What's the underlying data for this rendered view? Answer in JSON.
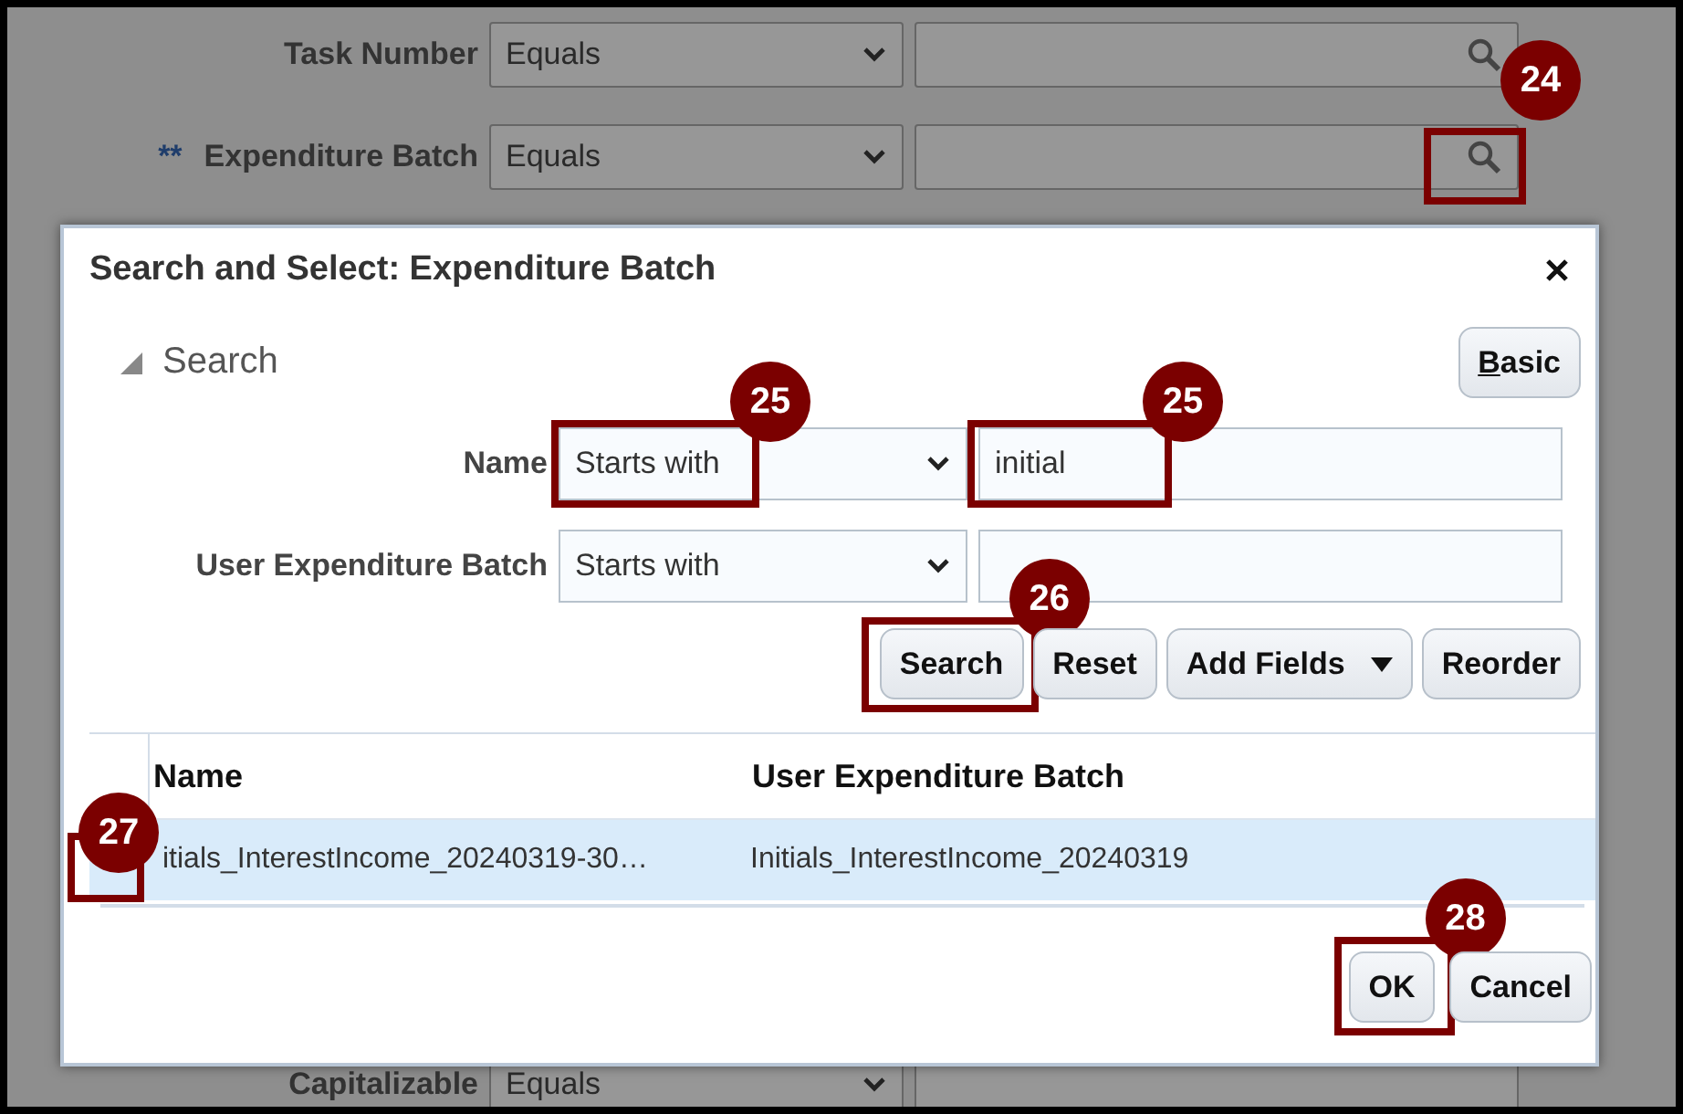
{
  "background_form": {
    "rows": [
      {
        "label": "Task Number",
        "operator": "Equals",
        "lookup": true
      },
      {
        "marker": "**",
        "label": "Expenditure Batch",
        "operator": "Equals",
        "lookup": true,
        "lookup_callout": "24"
      },
      {
        "label": "Capitalizable",
        "operator": "Equals",
        "lookup": false
      }
    ]
  },
  "dialog": {
    "title": "Search and Select: Expenditure Batch",
    "search_section": {
      "label": "Search",
      "expanded": true,
      "mode_button": {
        "label": "Basic"
      },
      "fields": [
        {
          "label": "Name",
          "operator": "Starts with",
          "value": "initial",
          "operator_callout": "25",
          "value_callout": "25"
        },
        {
          "label": "User Expenditure Batch",
          "operator": "Starts with"
        }
      ],
      "buttons": [
        {
          "label": "Search",
          "callout": "26"
        },
        {
          "label": "Reset"
        },
        {
          "label": "Add Fields",
          "menu": true
        },
        {
          "label": "Reorder"
        }
      ]
    },
    "table": {
      "columns": [
        "Name",
        "User Expenditure Batch"
      ],
      "rows": [
        {
          "selected": true,
          "selector_callout": "27",
          "cells": [
            "itials_InterestIncome_20240319-30…",
            "Initials_InterestIncome_20240319"
          ]
        }
      ]
    },
    "footer_buttons": [
      {
        "label": "OK",
        "callout": "28"
      },
      {
        "label": "Cancel"
      }
    ]
  }
}
